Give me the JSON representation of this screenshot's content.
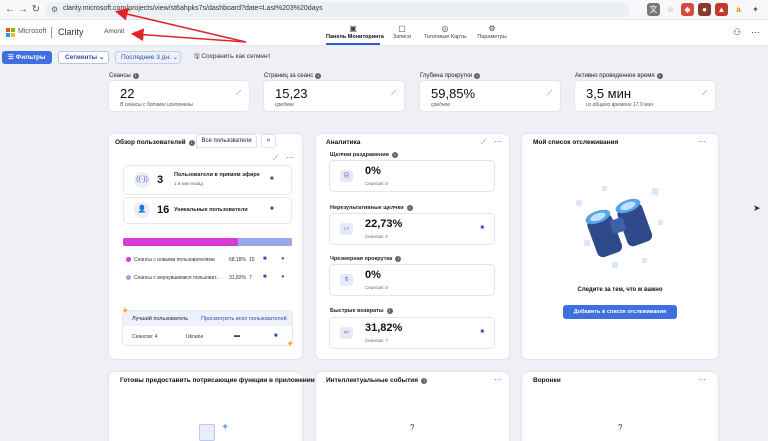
{
  "browser": {
    "url": "clarity.microsoft.com/projects/view/st6ahpks7s/dashboard?date=Last%203%20days"
  },
  "app": {
    "brand": "Microsoft",
    "name": "Clarity",
    "project": "Amonit"
  },
  "nav": {
    "tabs": [
      {
        "label": "Панель Мониторинга",
        "active": true
      },
      {
        "label": "Записи"
      },
      {
        "label": "Тепловые Карты"
      },
      {
        "label": "Параметры"
      }
    ]
  },
  "toolbar": {
    "filters": "Фильтры",
    "segments": "Сегменты",
    "date_range": "Последние 3 дн.",
    "save_segment": "Сохранить как сегмент"
  },
  "metrics": [
    {
      "label": "Сеансы",
      "value": "22",
      "sub": "В сеансы с ботами исключены"
    },
    {
      "label": "Страниц за сеанс",
      "value": "15,23",
      "sub": "среднее"
    },
    {
      "label": "Глубина прокрутки",
      "value": "59,85%",
      "sub": "среднее"
    },
    {
      "label": "Активно проведенное время",
      "value": "3,5 мин",
      "sub": "из общего времени 17,9 мин"
    }
  ],
  "users_panel": {
    "title": "Обзор пользователей",
    "tab_all": "Все пользователи",
    "live": {
      "count": "3",
      "title": "Пользователи в прямом эфире",
      "sub": "1.9 мин назад"
    },
    "unique": {
      "count": "16",
      "title": "Уникальные пользователи"
    },
    "new_share": 68.18,
    "legend": [
      {
        "label": "Сеансы с новыми пользователями",
        "pct": "68,18%",
        "count": "15",
        "color": "#d63ad8"
      },
      {
        "label": "Сеансы с вернувшимися пользоват...",
        "pct": "31,82%",
        "count": "7",
        "color": "#9aa6ec"
      }
    ],
    "best_user": {
      "title": "Лучший пользователь",
      "link": "Просмотреть всех пользователей",
      "sessions": "Сеансов: 4",
      "country": "Ukraine"
    }
  },
  "analytics": {
    "title": "Аналитика",
    "items": [
      {
        "label": "Щелчки раздражения",
        "value": "0%",
        "sub": "Сеансов: 0",
        "has_cam": false
      },
      {
        "label": "Нерезультативные щелчки",
        "value": "22,73%",
        "sub": "Сеансов: 5",
        "has_cam": true
      },
      {
        "label": "Чрезмерная прокрутка",
        "value": "0%",
        "sub": "Сеансов: 0",
        "has_cam": false
      },
      {
        "label": "Быстрые возвраты",
        "value": "31,82%",
        "sub": "Сеансов: 7",
        "has_cam": true
      }
    ]
  },
  "watchlist": {
    "title": "Мой список отслеживания",
    "text": "Следите за тем, что м важно",
    "button": "Добавить в список отслеживания"
  },
  "bottom": {
    "ready": "Готовы предоставить потрясающие функции в приложении?",
    "smart_events": "Интеллектуальные события",
    "funnels": "Воронки",
    "question": "?"
  },
  "colors": {
    "accent": "#3f6fe0",
    "annotation": "#e0242b"
  }
}
